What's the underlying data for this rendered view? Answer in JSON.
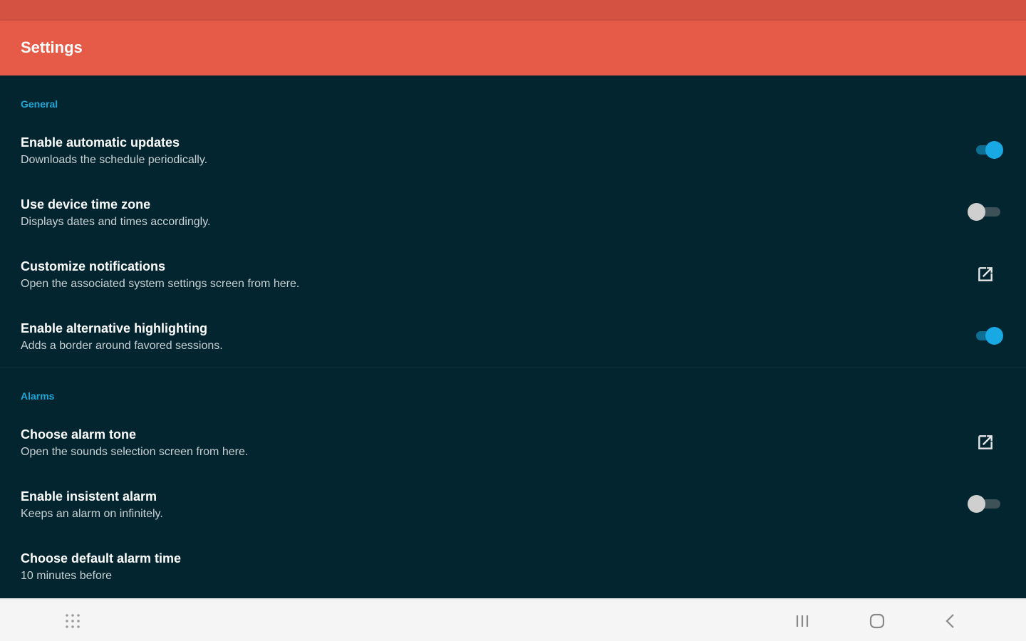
{
  "app_bar": {
    "title": "Settings"
  },
  "sections": {
    "general": {
      "header": "General",
      "items": [
        {
          "title": "Enable automatic updates",
          "summary": "Downloads the schedule periodically.",
          "control": "switch",
          "checked": true
        },
        {
          "title": "Use device time zone",
          "summary": "Displays dates and times accordingly.",
          "control": "switch",
          "checked": false
        },
        {
          "title": "Customize notifications",
          "summary": "Open the associated system settings screen from here.",
          "control": "external-link-icon"
        },
        {
          "title": "Enable alternative highlighting",
          "summary": "Adds a border around favored sessions.",
          "control": "switch",
          "checked": true
        }
      ]
    },
    "alarms": {
      "header": "Alarms",
      "items": [
        {
          "title": "Choose alarm tone",
          "summary": "Open the sounds selection screen from here.",
          "control": "external-link-icon"
        },
        {
          "title": "Enable insistent alarm",
          "summary": "Keeps an alarm on infinitely.",
          "control": "switch",
          "checked": false
        },
        {
          "title": "Choose default alarm time",
          "summary": "10 minutes before",
          "control": "none"
        }
      ]
    }
  },
  "nav_bar": {
    "icons": [
      "apps-grid-icon",
      "recent-apps-icon",
      "home-icon",
      "back-icon"
    ]
  },
  "colors": {
    "status_bar": "#d35241",
    "app_bar": "#e55b47",
    "background": "#022530",
    "accent": "#1fa6d6",
    "switch_on": "#18a9e4",
    "switch_off": "#cfcfcf"
  }
}
